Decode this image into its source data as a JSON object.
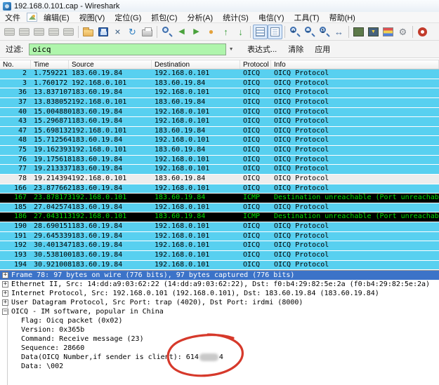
{
  "window": {
    "title": "192.168.0.101.cap - Wireshark"
  },
  "menu": {
    "items": [
      {
        "name": "file",
        "label": "文件",
        "artifact": true
      },
      {
        "name": "edit",
        "label": "编辑(E)"
      },
      {
        "name": "view",
        "label": "视图(V)"
      },
      {
        "name": "go",
        "label": "定位(G)"
      },
      {
        "name": "capture",
        "label": "抓包(C)"
      },
      {
        "name": "analyze",
        "label": "分析(A)"
      },
      {
        "name": "statistics",
        "label": "统计(S)"
      },
      {
        "name": "telephony",
        "label": "电信(Y)"
      },
      {
        "name": "tools",
        "label": "工具(T)"
      },
      {
        "name": "help",
        "label": "帮助(H)"
      }
    ]
  },
  "toolbar": {
    "icons": [
      {
        "name": "interfaces-icon",
        "kind": "nic",
        "disabled": true
      },
      {
        "name": "capture-options-icon",
        "kind": "nic",
        "disabled": true
      },
      {
        "name": "capture-start-icon",
        "kind": "nic",
        "disabled": true
      },
      {
        "name": "capture-stop-icon",
        "kind": "nic",
        "disabled": true
      },
      {
        "name": "capture-restart-icon",
        "kind": "nic",
        "disabled": true
      },
      {
        "sep": true
      },
      {
        "name": "open-file-icon",
        "kind": "folder"
      },
      {
        "name": "save-file-icon",
        "kind": "save"
      },
      {
        "name": "close-file-icon",
        "kind": "glyph",
        "glyph": "×",
        "color": "#35597f",
        "size": "14px"
      },
      {
        "name": "reload-icon",
        "kind": "glyph",
        "glyph": "↻",
        "color": "#2e7fc1",
        "size": "13px"
      },
      {
        "name": "print-icon",
        "kind": "printer"
      },
      {
        "sep": true
      },
      {
        "name": "find-icon",
        "kind": "mag"
      },
      {
        "name": "back-icon",
        "kind": "glyph",
        "glyph": "◀",
        "color": "#4aa23c",
        "size": "11px"
      },
      {
        "name": "forward-icon",
        "kind": "glyph",
        "glyph": "▶",
        "color": "#4aa23c",
        "size": "11px"
      },
      {
        "name": "goto-packet-icon",
        "kind": "glyph",
        "glyph": "●",
        "color": "#e3a23c",
        "size": "12px"
      },
      {
        "name": "go-top-icon",
        "kind": "glyph",
        "glyph": "↑",
        "color": "#3f9e3f",
        "size": "13px"
      },
      {
        "name": "go-bottom-icon",
        "kind": "glyph",
        "glyph": "↓",
        "color": "#3f9e3f",
        "size": "13px"
      },
      {
        "sep": true
      },
      {
        "name": "colorize-icon",
        "kind": "lines",
        "pressed": true
      },
      {
        "name": "autoscroll-icon",
        "kind": "linespg",
        "pressed": true
      },
      {
        "sep": true
      },
      {
        "name": "zoom-in-icon",
        "kind": "mag",
        "sub": "+"
      },
      {
        "name": "zoom-out-icon",
        "kind": "mag",
        "sub": "−"
      },
      {
        "name": "zoom-100-icon",
        "kind": "mag",
        "sub": "1"
      },
      {
        "name": "resize-columns-icon",
        "kind": "glyph",
        "glyph": "↔",
        "color": "#4a6c9b",
        "size": "13px"
      },
      {
        "sep": true
      },
      {
        "name": "capture-filter-icon",
        "kind": "square",
        "color": "#5d7a4a"
      },
      {
        "name": "display-filter-icon",
        "kind": "square",
        "color": "#46627e",
        "sub": "▼",
        "subcolor": "#f3d13c"
      },
      {
        "name": "coloring-rules-icon",
        "kind": "colors"
      },
      {
        "name": "preferences-icon",
        "kind": "glyph",
        "glyph": "⚙",
        "color": "#7d8289",
        "size": "13px"
      },
      {
        "sep": true
      },
      {
        "name": "help-icon",
        "kind": "ring"
      }
    ]
  },
  "filter": {
    "label": "过滤:",
    "value": "oicq",
    "dropdown_glyph": "▼",
    "expression_button": "表达式...",
    "clear_button": "清除",
    "apply_button": "应用"
  },
  "packet_list": {
    "columns": [
      "No.",
      "Time",
      "Source",
      "Destination",
      "Protocol",
      "Info"
    ],
    "rows": [
      {
        "no": "2",
        "time": "1.759221",
        "source": "183.60.19.84",
        "destination": "192.168.0.101",
        "protocol": "OICQ",
        "info": "OICQ Protocol",
        "style": "udp"
      },
      {
        "no": "3",
        "time": "1.760172",
        "source": "192.168.0.101",
        "destination": "183.60.19.84",
        "protocol": "OICQ",
        "info": "OICQ Protocol",
        "style": "udp"
      },
      {
        "no": "36",
        "time": "13.837107",
        "source": "183.60.19.84",
        "destination": "192.168.0.101",
        "protocol": "OICQ",
        "info": "OICQ Protocol",
        "style": "udp"
      },
      {
        "no": "37",
        "time": "13.838052",
        "source": "192.168.0.101",
        "destination": "183.60.19.84",
        "protocol": "OICQ",
        "info": "OICQ Protocol",
        "style": "udp"
      },
      {
        "no": "40",
        "time": "15.004880",
        "source": "183.60.19.84",
        "destination": "192.168.0.101",
        "protocol": "OICQ",
        "info": "OICQ Protocol",
        "style": "udp"
      },
      {
        "no": "43",
        "time": "15.296871",
        "source": "183.60.19.84",
        "destination": "192.168.0.101",
        "protocol": "OICQ",
        "info": "OICQ Protocol",
        "style": "udp"
      },
      {
        "no": "47",
        "time": "15.698132",
        "source": "192.168.0.101",
        "destination": "183.60.19.84",
        "protocol": "OICQ",
        "info": "OICQ Protocol",
        "style": "udp"
      },
      {
        "no": "48",
        "time": "15.712564",
        "source": "183.60.19.84",
        "destination": "192.168.0.101",
        "protocol": "OICQ",
        "info": "OICQ Protocol",
        "style": "udp"
      },
      {
        "no": "75",
        "time": "19.162393",
        "source": "192.168.0.101",
        "destination": "183.60.19.84",
        "protocol": "OICQ",
        "info": "OICQ Protocol",
        "style": "udp"
      },
      {
        "no": "76",
        "time": "19.175618",
        "source": "183.60.19.84",
        "destination": "192.168.0.101",
        "protocol": "OICQ",
        "info": "OICQ Protocol",
        "style": "udp"
      },
      {
        "no": "77",
        "time": "19.213337",
        "source": "183.60.19.84",
        "destination": "192.168.0.101",
        "protocol": "OICQ",
        "info": "OICQ Protocol",
        "style": "udp"
      },
      {
        "no": "78",
        "time": "19.214394",
        "source": "192.168.0.101",
        "destination": "183.60.19.84",
        "protocol": "OICQ",
        "info": "OICQ Protocol",
        "style": "selected"
      },
      {
        "no": "166",
        "time": "23.877662",
        "source": "183.60.19.84",
        "destination": "192.168.0.101",
        "protocol": "OICQ",
        "info": "OICQ Protocol",
        "style": "udp"
      },
      {
        "no": "167",
        "time": "23.878173",
        "source": "192.168.0.101",
        "destination": "183.60.19.84",
        "protocol": "ICMP",
        "info": "Destination unreachable (Port unreachable)",
        "style": "icmp"
      },
      {
        "no": "185",
        "time": "27.042574",
        "source": "183.60.19.84",
        "destination": "192.168.0.101",
        "protocol": "OICQ",
        "info": "OICQ Protocol",
        "style": "udp"
      },
      {
        "no": "186",
        "time": "27.043113",
        "source": "192.168.0.101",
        "destination": "183.60.19.84",
        "protocol": "ICMP",
        "info": "Destination unreachable (Port unreachable)",
        "style": "icmp"
      },
      {
        "no": "190",
        "time": "28.690151",
        "source": "183.60.19.84",
        "destination": "192.168.0.101",
        "protocol": "OICQ",
        "info": "OICQ Protocol",
        "style": "udp"
      },
      {
        "no": "191",
        "time": "29.645339",
        "source": "183.60.19.84",
        "destination": "192.168.0.101",
        "protocol": "OICQ",
        "info": "OICQ Protocol",
        "style": "udp"
      },
      {
        "no": "192",
        "time": "30.401347",
        "source": "183.60.19.84",
        "destination": "192.168.0.101",
        "protocol": "OICQ",
        "info": "OICQ Protocol",
        "style": "udp"
      },
      {
        "no": "193",
        "time": "30.538100",
        "source": "183.60.19.84",
        "destination": "192.168.0.101",
        "protocol": "OICQ",
        "info": "OICQ Protocol",
        "style": "udp"
      },
      {
        "no": "194",
        "time": "30.921008",
        "source": "183.60.19.84",
        "destination": "192.168.0.101",
        "protocol": "OICQ",
        "info": "OICQ Protocol",
        "style": "udp"
      }
    ]
  },
  "details": {
    "lines": [
      {
        "name": "frame",
        "expand": "+",
        "selected": true,
        "text": "Frame 78: 97 bytes on wire (776 bits), 97 bytes captured (776 bits)"
      },
      {
        "name": "ethernet",
        "expand": "+",
        "text": "Ethernet II, Src: 14:dd:a9:03:62:22 (14:dd:a9:03:62:22), Dst: f0:b4:29:82:5e:2a (f0:b4:29:82:5e:2a)"
      },
      {
        "name": "ip",
        "expand": "+",
        "text": "Internet Protocol, Src: 192.168.0.101 (192.168.0.101), Dst: 183.60.19.84 (183.60.19.84)"
      },
      {
        "name": "udp",
        "expand": "+",
        "text": "User Datagram Protocol, Src Port: trap (4020), Dst Port: irdmi (8000)"
      },
      {
        "name": "oicq",
        "expand": "−",
        "text": "OICQ - IM software, popular in China"
      },
      {
        "name": "oicq-flag",
        "child": true,
        "text": "Flag: Oicq packet (0x02)"
      },
      {
        "name": "oicq-version",
        "child": true,
        "text": "Version: 0x365b"
      },
      {
        "name": "oicq-command",
        "child": true,
        "text": "Command: Receive message (23)"
      },
      {
        "name": "oicq-sequence",
        "child": true,
        "text": "Sequence: 28660"
      },
      {
        "name": "oicq-number",
        "child": true,
        "text": "Data(OICQ Number,if sender is client): 614",
        "redacted": true,
        "text_after": "4"
      },
      {
        "name": "oicq-data",
        "child": true,
        "text": "Data: \\002"
      }
    ]
  },
  "annotation": {
    "shape": "hand-drawn-circle",
    "color": "#d6392b",
    "target": "oicq-number-value"
  },
  "colors": {
    "row_oicq_bg": "#58d0f0",
    "row_icmp_bg": "#000000",
    "row_icmp_fg": "#00e000",
    "row_selected_bg": "#ededed",
    "detail_selected_bg": "#3c73c8",
    "filter_valid_bg": "#aff5ac",
    "annotation_red": "#d6392b"
  }
}
